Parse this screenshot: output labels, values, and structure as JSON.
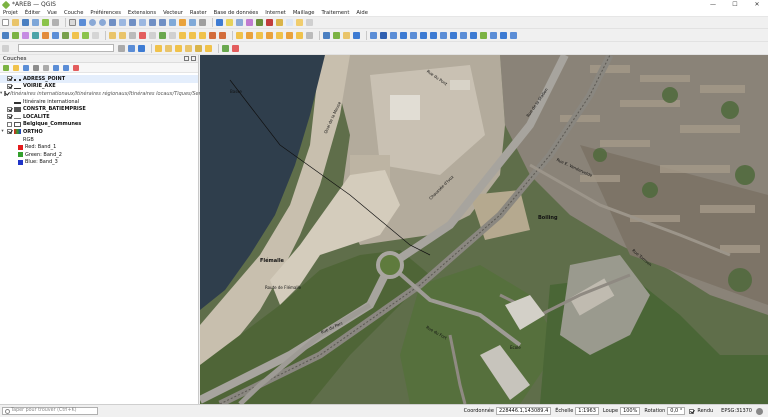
{
  "window": {
    "title": "*AREB — QGIS",
    "minimize": "—",
    "maximize": "☐",
    "close": "✕"
  },
  "menu": [
    "Projet",
    "Éditer",
    "Vue",
    "Couche",
    "Préférences",
    "Extensions",
    "Vecteur",
    "Raster",
    "Base de données",
    "Internet",
    "Maillage",
    "Traitement",
    "Aide"
  ],
  "panel": {
    "title": "Couches"
  },
  "layers": [
    {
      "id": "adress",
      "label": "ADRESS_POINT"
    },
    {
      "id": "voirie",
      "label": "VOIRIE_AXE"
    },
    {
      "id": "itin",
      "label": "Itinéraires internationaux/Itinéraires régionaux/Itinéraires locaux/Tiques/Sentiers"
    },
    {
      "id": "itin_int",
      "label": "Itinéraire international"
    },
    {
      "id": "constr",
      "label": "CONSTR_BATIEMPRISE"
    },
    {
      "id": "localite",
      "label": "LOCALITE"
    },
    {
      "id": "communes",
      "label": "Belgique_Communes"
    },
    {
      "id": "ortho",
      "label": "ORTHO"
    },
    {
      "id": "rgb",
      "label": "RGB"
    },
    {
      "id": "red",
      "label": "Red:  Band_1"
    },
    {
      "id": "green",
      "label": "Green: Band_2"
    },
    {
      "id": "blue",
      "label": "Blue:  Band_3"
    }
  ],
  "map": {
    "labels": {
      "flemalle": "Flémalle",
      "bas": "Basse",
      "boiling": "Boiling",
      "rue1": "Rue du Pont",
      "rue2": "Rue de la Station",
      "rue3": "Chaussée d'Ivoz",
      "rue4": "Quai de la Meuse",
      "rue5": "Rue du Parc",
      "rue6": "Rue E. Vandervelde",
      "rue7": "Rue Tomson",
      "rue8": "Route de Flémalle",
      "rue9": "Rue du Fort",
      "rue10": "Ecole"
    }
  },
  "status": {
    "locator_placeholder": "Taper pour trouver (Ctrl+K)",
    "coord_label": "Coordonnée",
    "coord_value": "228446.1,143089.4",
    "scale_label": "Échelle",
    "scale_value": "1:1963",
    "magnifier_label": "Loupe",
    "magnifier_value": "100%",
    "rotation_label": "Rotation",
    "rotation_value": "0,0 °",
    "render_label": "Rendu",
    "crs": "EPSG:31370"
  },
  "colors": {
    "red_band": "#e31a1c",
    "green_band": "#33a02c",
    "blue_band": "#1f34c8"
  }
}
